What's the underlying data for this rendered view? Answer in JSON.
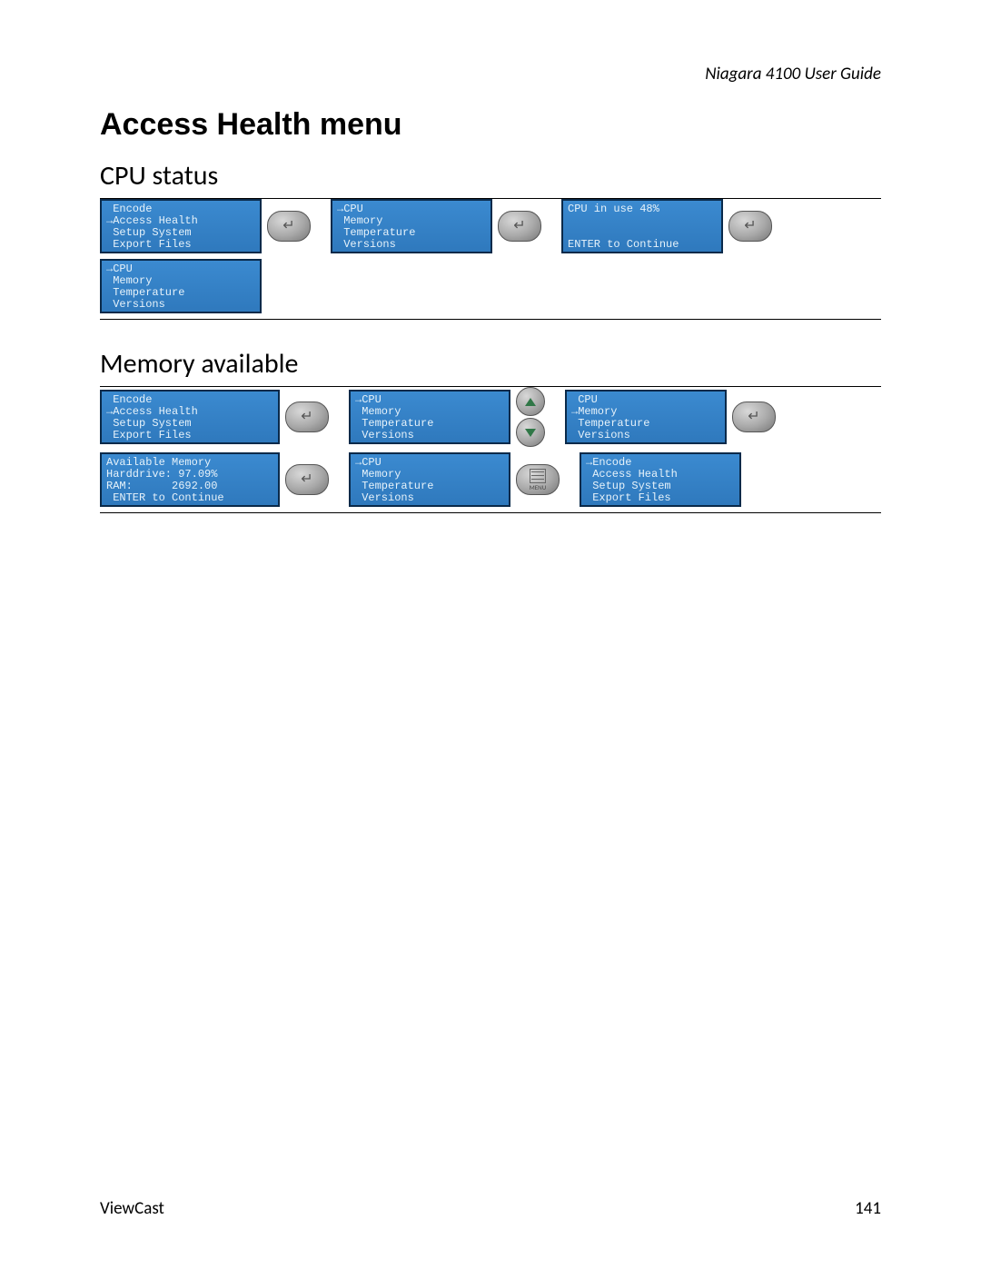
{
  "header": {
    "doc_title": "Niagara 4100 User Guide"
  },
  "title": "Access Health menu",
  "cpu_section": {
    "heading": "CPU status",
    "screens": {
      "s1": " Encode\n→Access Health\n Setup System\n Export Files",
      "s2": "→CPU\n Memory\n Temperature\n Versions",
      "s3": "CPU in use 48%\n\n\nENTER to Continue",
      "s4": "→CPU\n Memory\n Temperature\n Versions"
    }
  },
  "mem_section": {
    "heading": "Memory available",
    "screens": {
      "m1": " Encode\n→Access Health\n Setup System\n Export Files",
      "m2": "→CPU\n Memory\n Temperature\n Versions",
      "m3": " CPU\n→Memory\n Temperature\n Versions",
      "m4": "Available Memory\nHarddrive: 97.09%\nRAM:      2692.00\n ENTER to Continue",
      "m5": "→CPU\n Memory\n Temperature\n Versions",
      "m6": "→Encode\n Access Health\n Setup System\n Export Files"
    }
  },
  "footer": {
    "brand": "ViewCast",
    "page": "141"
  },
  "buttons": {
    "menu_label": "MENU"
  }
}
